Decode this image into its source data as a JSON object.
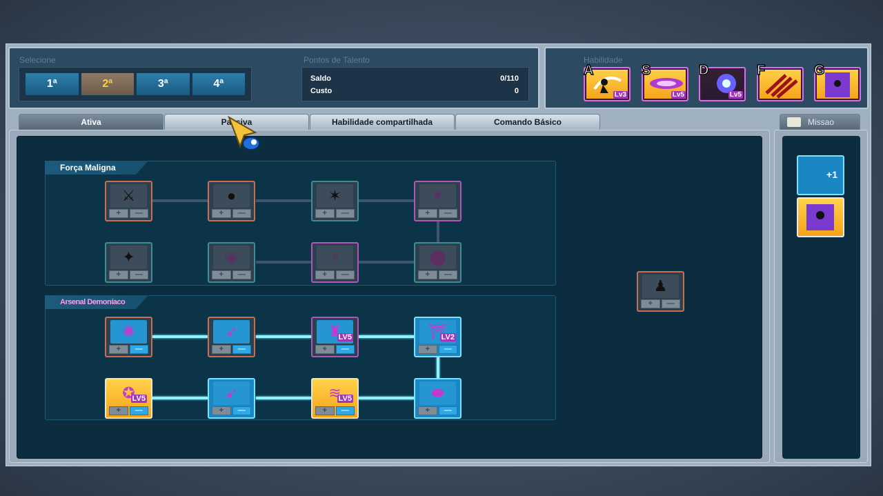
{
  "header": {
    "selecione_label": "Selecione",
    "selector": [
      "1ª",
      "2ª",
      "3ª",
      "4ª"
    ],
    "selected_index": 1,
    "talent_label": "Pontos de Talento",
    "saldo_label": "Saldo",
    "saldo_value": "0/110",
    "custo_label": "Custo",
    "custo_value": "0",
    "habilidade_label": "Habilidade",
    "hotkeys": [
      {
        "key": "A",
        "lv": "Lv3"
      },
      {
        "key": "S",
        "lv": "Lv5"
      },
      {
        "key": "D",
        "lv": "Lv5"
      },
      {
        "key": "F",
        "lv": ""
      },
      {
        "key": "G",
        "lv": ""
      }
    ]
  },
  "tabs": [
    "Ativa",
    "Passiva",
    "Habilidade compartilhada",
    "Comando Básico"
  ],
  "active_tab": 0,
  "side": {
    "tab_label": "Missao",
    "plus_badge": "+1"
  },
  "trees": [
    {
      "title": "Força Maligna"
    },
    {
      "title": "Arsenal Demoníaco"
    }
  ],
  "node_levels": {
    "arsenal_r1_c3": "LV5",
    "arsenal_r1_c4": "LV2",
    "arsenal_r2_c1": "LV5",
    "arsenal_r2_c3": "LV5"
  },
  "node_button_plus": "+",
  "node_button_minus": "—",
  "colors": {
    "frame": "#9fb0c0",
    "panel": "#2d4a63",
    "tree_bg": "#0b3448",
    "active_link": "#8ff0ff",
    "inactive_link": "#3d5668",
    "highlight_selector": "#ffd23a"
  }
}
